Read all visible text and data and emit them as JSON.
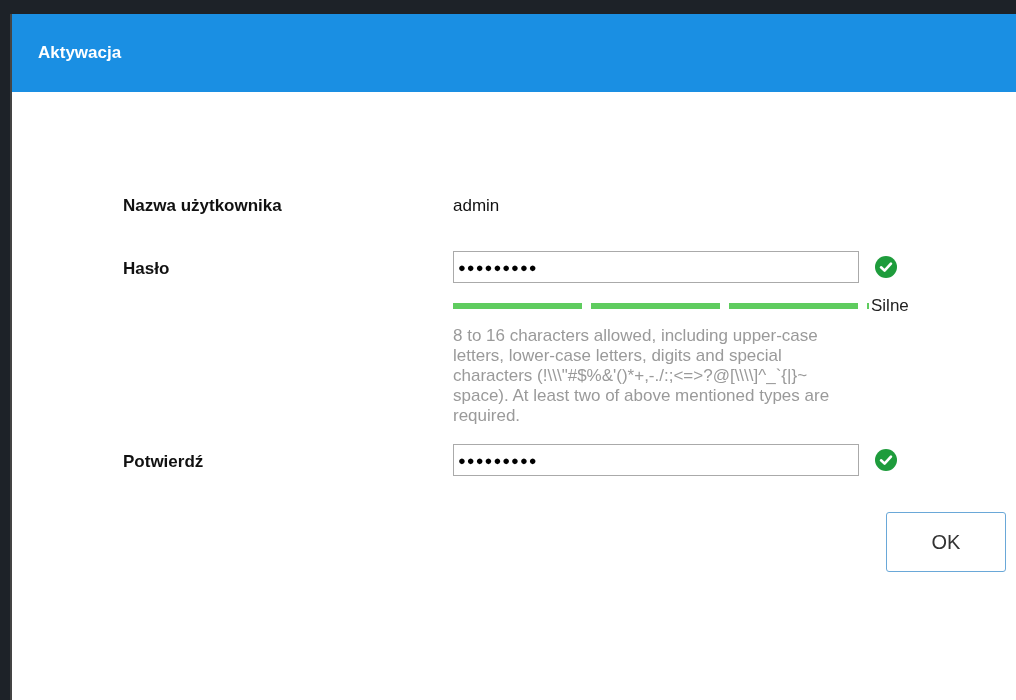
{
  "dialog": {
    "title": "Aktywacja"
  },
  "fields": [
    {
      "kind": "text",
      "label": "Nazwa użytkownika",
      "value": "admin"
    },
    {
      "kind": "password",
      "label": "Hasło",
      "value": "●●●●●●●●●",
      "valid": true,
      "strength": {
        "level": 1,
        "label": "Silne"
      },
      "hint": "8 to 16 characters allowed, including upper-case letters, lower-case letters, digits and special characters (!\\\\\\\"#$%&'()*+,-./:;<=>?@[\\\\\\\\]^_`{|}~ space). At least two of above mentioned types are required."
    },
    {
      "kind": "password",
      "label": "Potwierdź",
      "value": "●●●●●●●●●",
      "valid": true
    }
  ],
  "buttons": [
    "OK"
  ]
}
